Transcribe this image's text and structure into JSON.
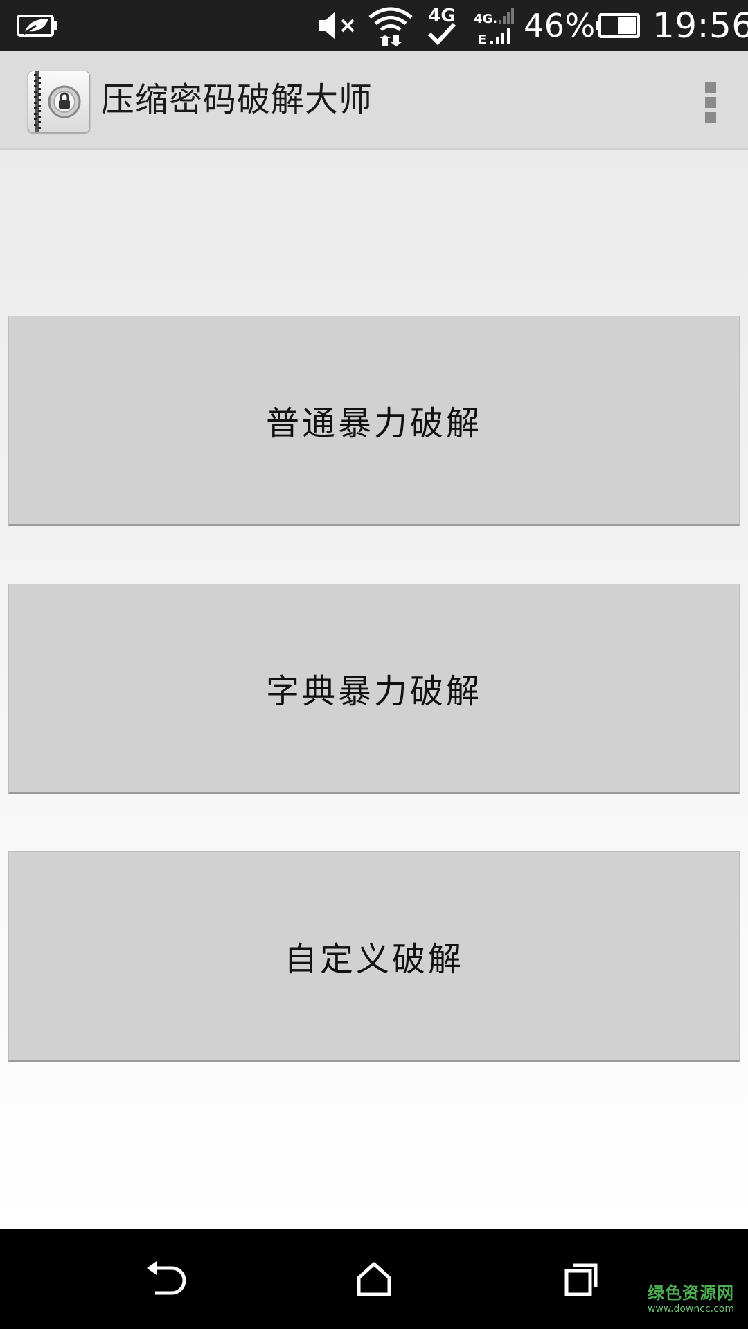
{
  "status_bar": {
    "battery_percent": "46%",
    "time": "19:56",
    "network_label": "4G",
    "icons": [
      "battery-saver-icon",
      "mute-icon",
      "wifi-icon",
      "4g-icon",
      "signal-icon",
      "battery-icon"
    ]
  },
  "action_bar": {
    "title": "压缩密码破解大师",
    "app_icon": "zip-lock-app-icon",
    "menu_icon": "overflow-menu-icon"
  },
  "main": {
    "buttons": [
      {
        "label": "普通暴力破解"
      },
      {
        "label": "字典暴力破解"
      },
      {
        "label": "自定义破解"
      }
    ]
  },
  "nav_bar": {
    "icons": [
      "back-icon",
      "home-icon",
      "recents-icon"
    ]
  },
  "watermark": {
    "main": "绿色资源网",
    "sub": "www.downcc.com"
  },
  "colors": {
    "status_bar_bg": "#1f1f1f",
    "action_bar_bg": "#dcdcdc",
    "button_bg": "#d1d1d1",
    "nav_bar_bg": "#000000",
    "watermark": "#4caf50"
  }
}
